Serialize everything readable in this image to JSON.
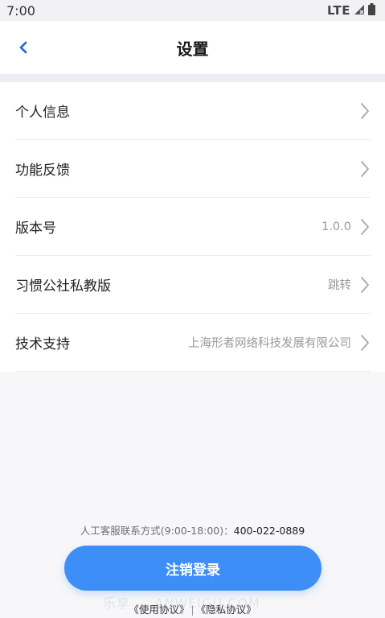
{
  "status_bar": {
    "time": "7:00",
    "network": "LTE"
  },
  "header": {
    "title": "设置",
    "back_icon": "chevron-left-icon"
  },
  "settings": [
    {
      "label": "个人信息",
      "value": ""
    },
    {
      "label": "功能反馈",
      "value": ""
    },
    {
      "label": "版本号",
      "value": "1.0.0"
    },
    {
      "label": "习惯公社私教版",
      "value": "跳转"
    },
    {
      "label": "技术支持",
      "value": "上海形者网络科技发展有限公司"
    }
  ],
  "footer": {
    "hotline_label": "人工客服联系方式(9:00-18:00)：",
    "hotline_number": "400-022-0889",
    "logout_label": "注销登录",
    "terms_link": "《使用协议》",
    "separator": "|",
    "privacy_link": "《隐私协议》",
    "watermark": "乐享 ... ANWEIGU.COM"
  },
  "colors": {
    "accent": "#3d8ef7",
    "chevron": "#a8a8a8"
  }
}
